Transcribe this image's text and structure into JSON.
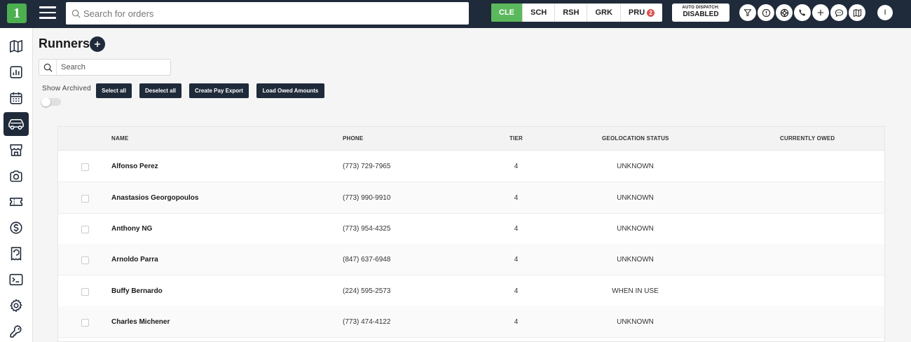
{
  "topbar": {
    "logo_text": "1",
    "search_placeholder": "Search for orders",
    "locations": [
      {
        "code": "CLE",
        "active": true
      },
      {
        "code": "SCH",
        "active": false
      },
      {
        "code": "RSH",
        "active": false
      },
      {
        "code": "GRK",
        "active": false
      },
      {
        "code": "PRU",
        "active": false,
        "badge": "2"
      }
    ],
    "auto_dispatch": {
      "label": "AUTO DISPATCH:",
      "value": "DISABLED"
    },
    "icons": [
      "filter-icon",
      "info-icon",
      "support-icon",
      "phone-icon",
      "plus-icon",
      "chat-icon",
      "map-icon"
    ],
    "avatar_initial": "I"
  },
  "sidebar": {
    "items": [
      {
        "name": "map-icon",
        "active": false
      },
      {
        "name": "chart-icon",
        "active": false
      },
      {
        "name": "calendar-icon",
        "active": false
      },
      {
        "name": "car-icon",
        "active": true
      },
      {
        "name": "store-icon",
        "active": false
      },
      {
        "name": "camera-icon",
        "active": false
      },
      {
        "name": "ticket-icon",
        "active": false
      },
      {
        "name": "dollar-icon",
        "active": false
      },
      {
        "name": "receipt-icon",
        "active": false
      },
      {
        "name": "terminal-icon",
        "active": false
      },
      {
        "name": "gear-icon",
        "active": false
      },
      {
        "name": "wrench-icon",
        "active": false
      }
    ]
  },
  "main": {
    "title": "Runners",
    "search_placeholder": "Search",
    "show_archived_label": "Show Archived",
    "buttons": {
      "select_all": "Select all",
      "deselect_all": "Deselect all",
      "create_pay_export": "Create Pay Export",
      "load_owed_amounts": "Load Owed Amounts"
    }
  },
  "table": {
    "columns": {
      "name": "NAME",
      "phone": "PHONE",
      "tier": "TIER",
      "geo": "GEOLOCATION STATUS",
      "owed": "CURRENTLY OWED"
    },
    "rows": [
      {
        "name": "Alfonso Perez",
        "phone": "(773) 729-7965",
        "tier": "4",
        "geo": "UNKNOWN"
      },
      {
        "name": "Anastasios Georgopoulos",
        "phone": "(773) 990-9910",
        "tier": "4",
        "geo": "UNKNOWN"
      },
      {
        "name": "Anthony NG",
        "phone": "(773) 954-4325",
        "tier": "4",
        "geo": "UNKNOWN"
      },
      {
        "name": "Arnoldo Parra",
        "phone": "(847) 637-6948",
        "tier": "4",
        "geo": "UNKNOWN"
      },
      {
        "name": "Buffy Bernardo",
        "phone": "(224) 595-2573",
        "tier": "4",
        "geo": "WHEN IN USE"
      },
      {
        "name": "Charles Michener",
        "phone": "(773) 474-4122",
        "tier": "4",
        "geo": "UNKNOWN"
      }
    ]
  },
  "colors": {
    "navy": "#1f2a3a",
    "active_location": "#5cb85c",
    "badge": "#d9534f",
    "logo": "#4caf50"
  }
}
